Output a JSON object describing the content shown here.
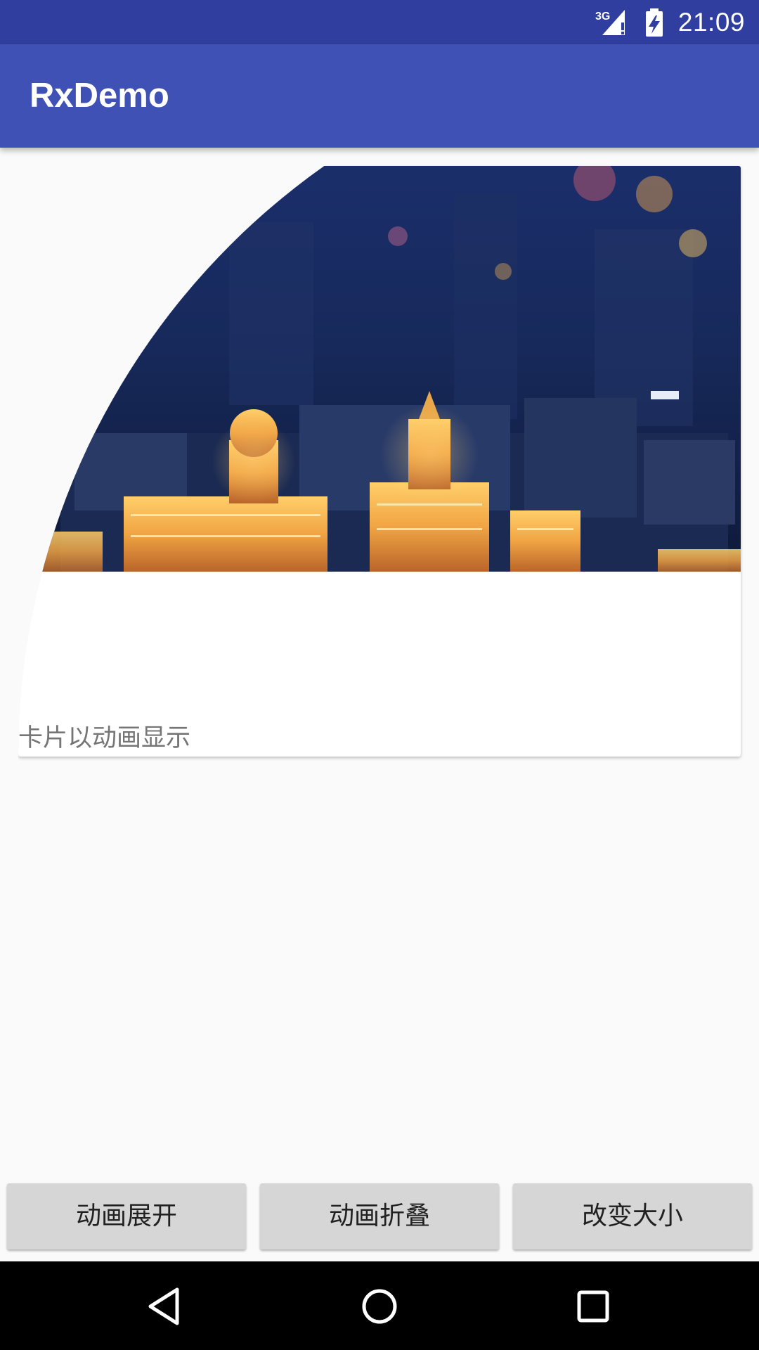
{
  "status_bar": {
    "network_label": "3G",
    "time": "21:09",
    "icons": [
      "signal-icon",
      "battery-icon"
    ]
  },
  "app_bar": {
    "title": "RxDemo"
  },
  "card": {
    "image": "night-city-skyline-image",
    "caption": "卡片以动画显示"
  },
  "buttons": {
    "expand_label": "动画展开",
    "collapse_label": "动画折叠",
    "resize_label": "改变大小"
  },
  "nav_bar": {
    "icons": [
      "back-icon",
      "home-icon",
      "recents-icon"
    ]
  },
  "colors": {
    "status_bar": "#303f9f",
    "app_bar": "#3f51b5",
    "background": "#fafafa",
    "button": "#d6d6d6"
  }
}
